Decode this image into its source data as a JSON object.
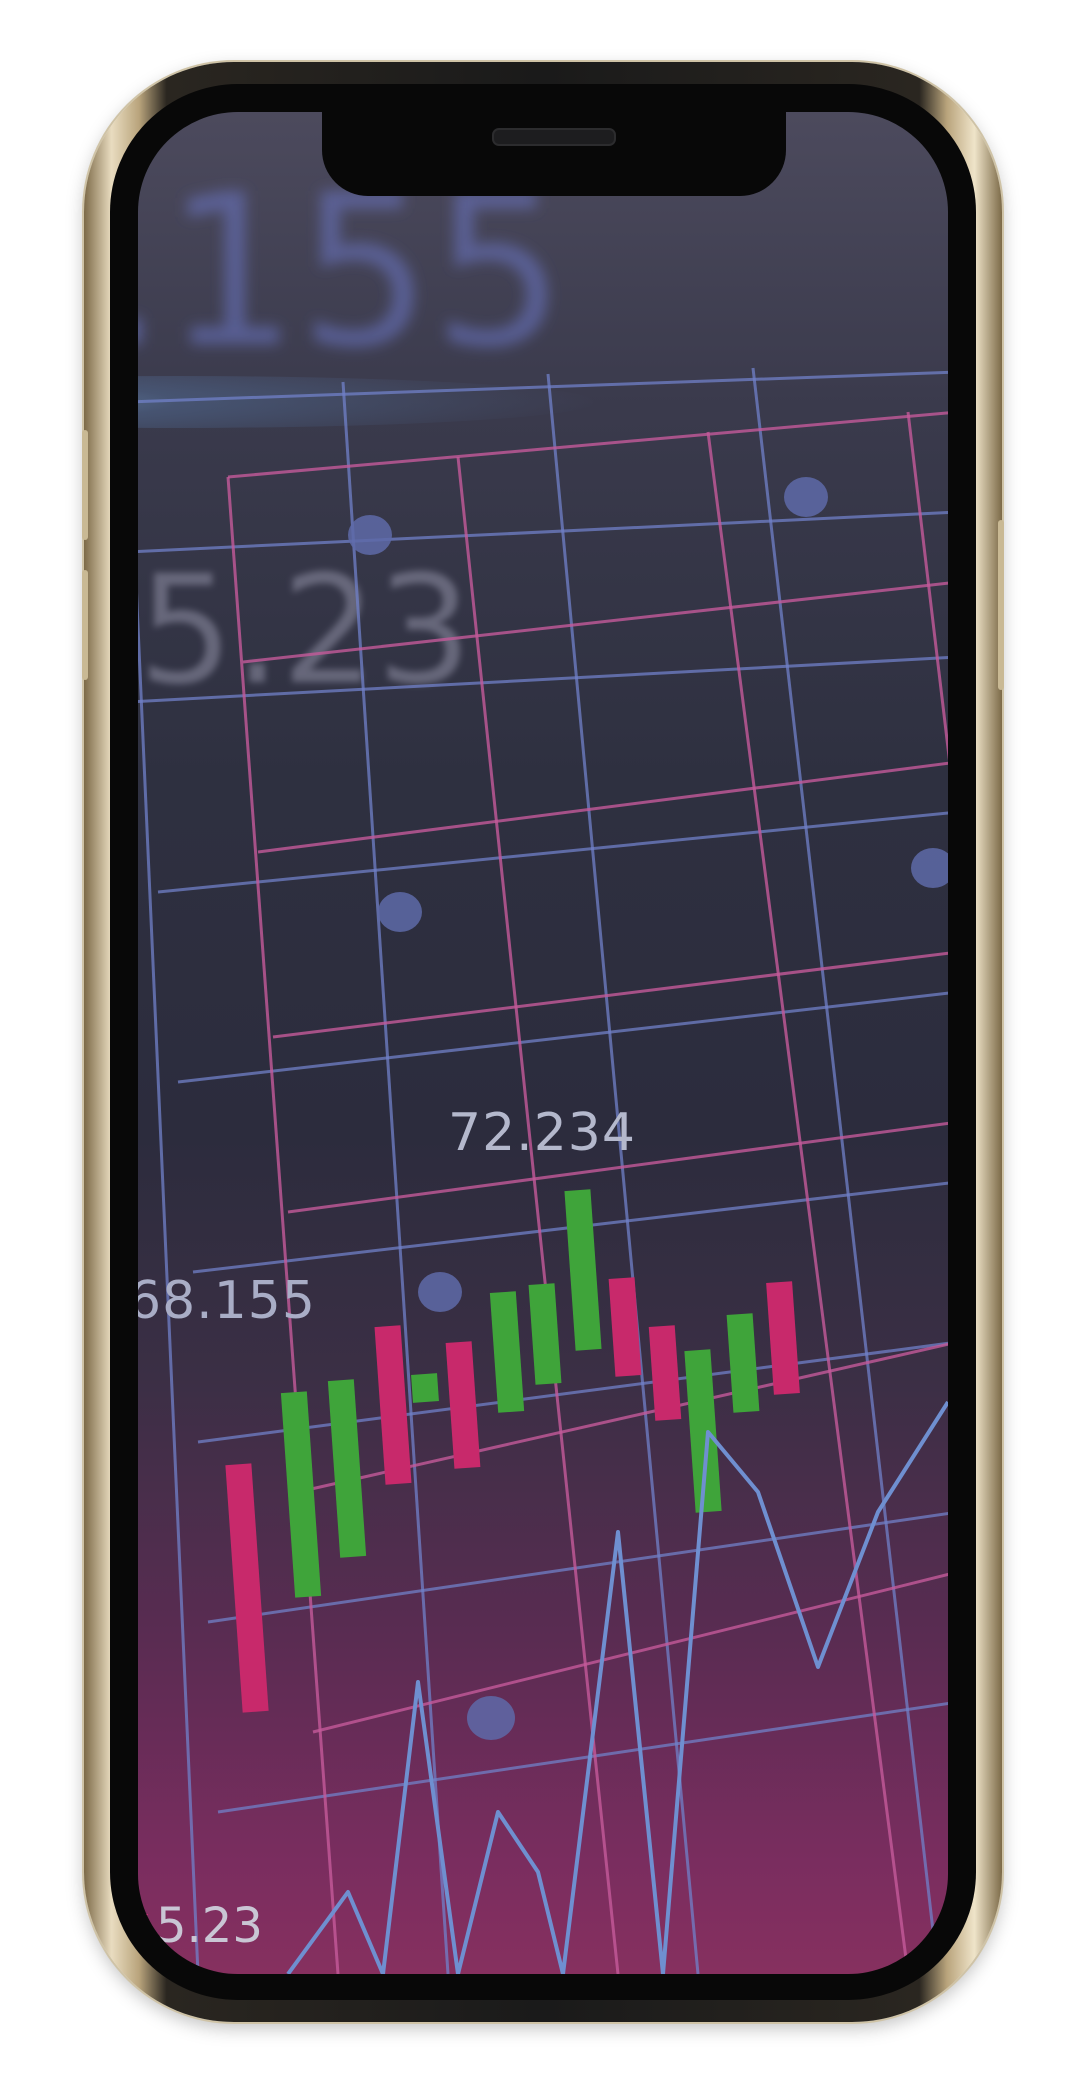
{
  "screen": {
    "bg_labels": {
      "top": ".155",
      "mid": "5.23"
    },
    "price_labels": {
      "high": "72.234",
      "left": "68.155",
      "bottom": "5.23"
    }
  },
  "chart_data": {
    "type": "candlestick",
    "title": "",
    "labels": [
      "72.234",
      "68.155",
      "5.23"
    ],
    "candles": [
      {
        "dir": "down"
      },
      {
        "dir": "up"
      },
      {
        "dir": "up"
      },
      {
        "dir": "down"
      },
      {
        "dir": "up"
      },
      {
        "dir": "down"
      },
      {
        "dir": "up"
      },
      {
        "dir": "up"
      },
      {
        "dir": "up"
      },
      {
        "dir": "down"
      },
      {
        "dir": "down"
      },
      {
        "dir": "up"
      },
      {
        "dir": "up"
      },
      {
        "dir": "down"
      }
    ],
    "colors": {
      "up": "#3fa43a",
      "down": "#c8296b",
      "grid_blue": "#7080c8",
      "grid_pink": "#c45a9a",
      "line": "#6f8fd0"
    }
  }
}
